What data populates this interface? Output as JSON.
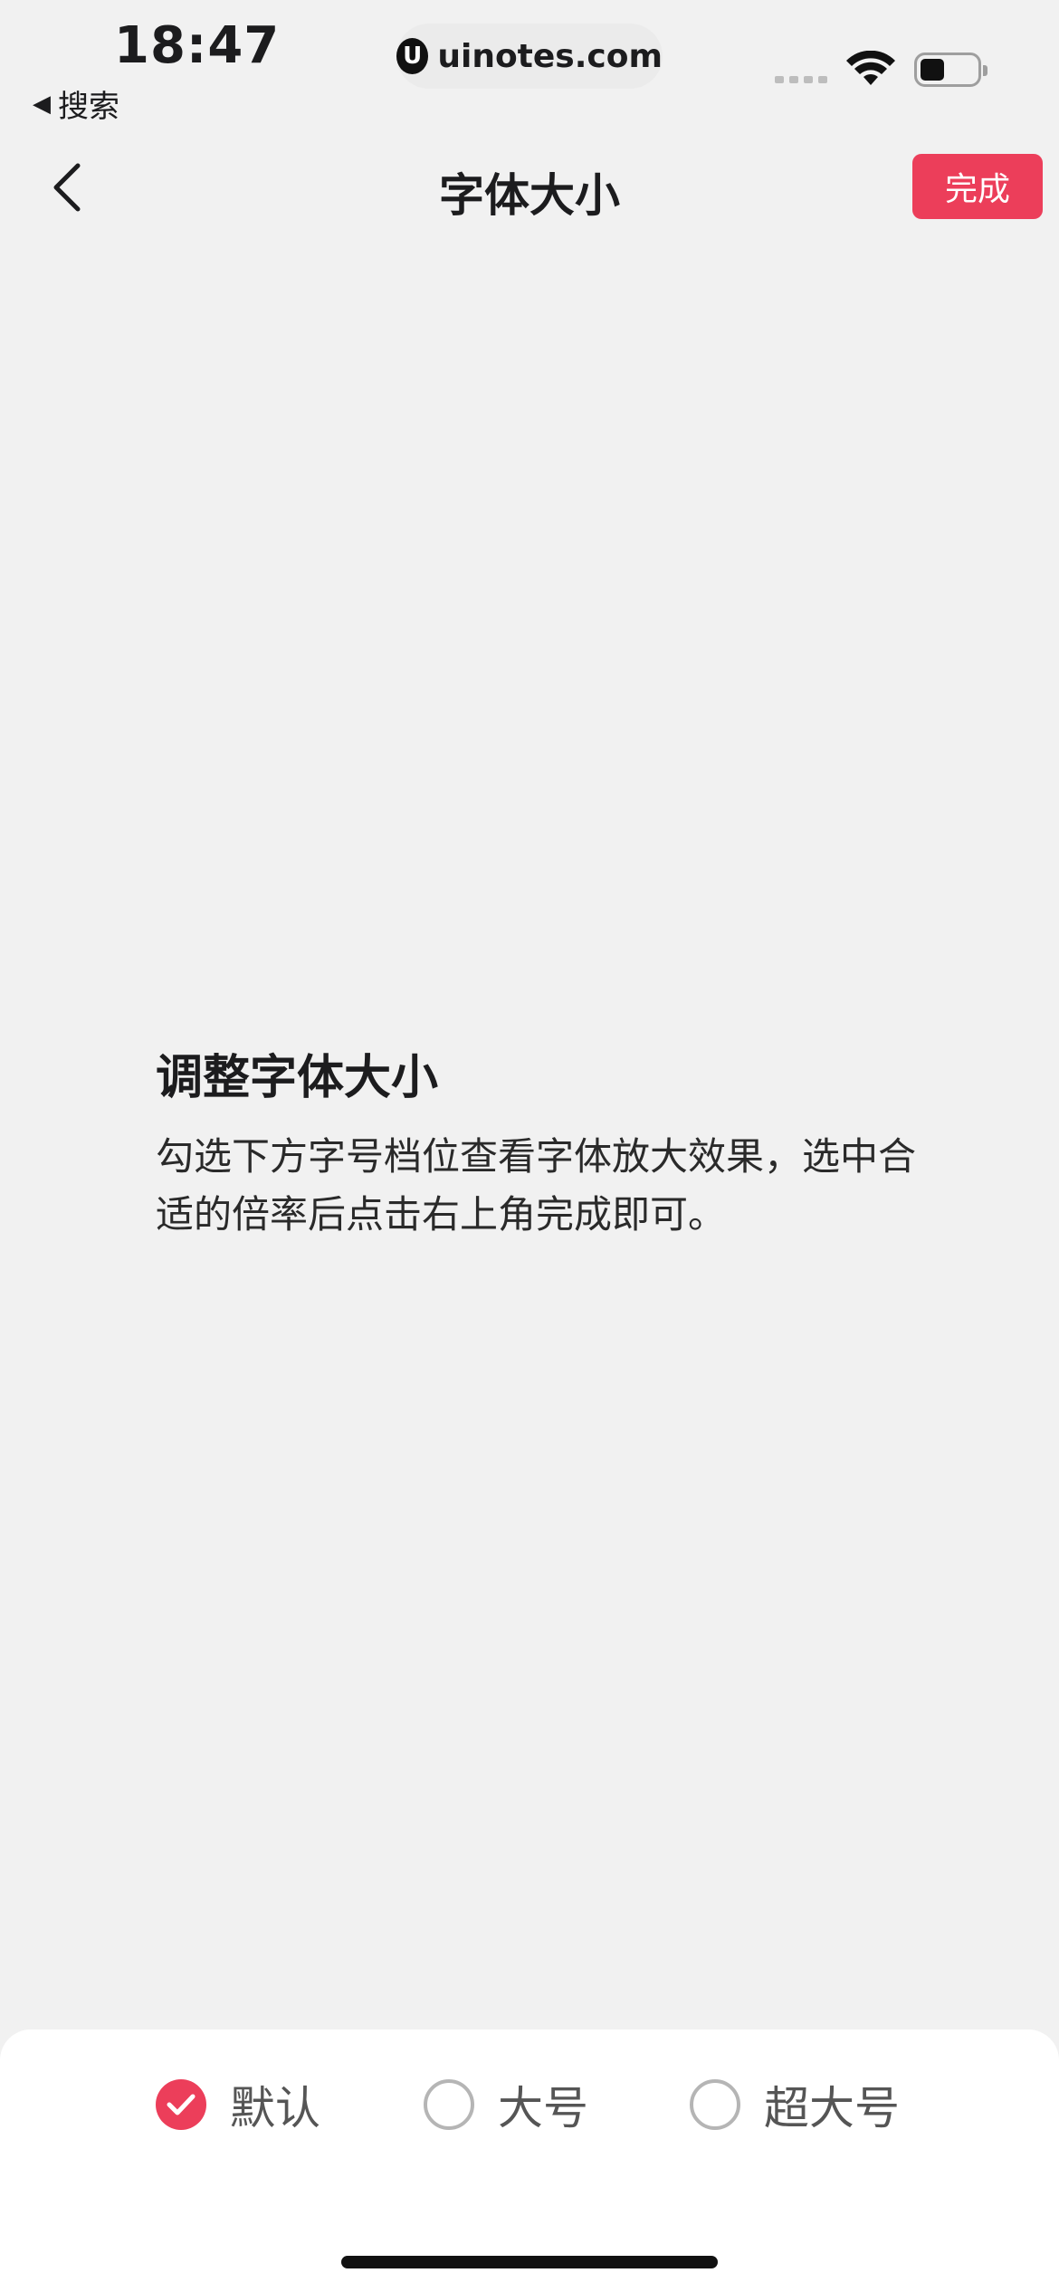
{
  "status_bar": {
    "time": "18:47",
    "back_app_label": "搜索",
    "url": "uinotes.com",
    "logo_glyph": "U"
  },
  "nav": {
    "title": "字体大小",
    "done_label": "完成"
  },
  "content": {
    "heading": "调整字体大小",
    "description": "勾选下方字号档位查看字体放大效果，选中合适的倍率后点击右上角完成即可。"
  },
  "font_options": [
    {
      "label": "默认",
      "selected": true
    },
    {
      "label": "大号",
      "selected": false
    },
    {
      "label": "超大号",
      "selected": false
    }
  ],
  "colors": {
    "accent": "#ec3e5a",
    "background": "#f1f1f1"
  }
}
